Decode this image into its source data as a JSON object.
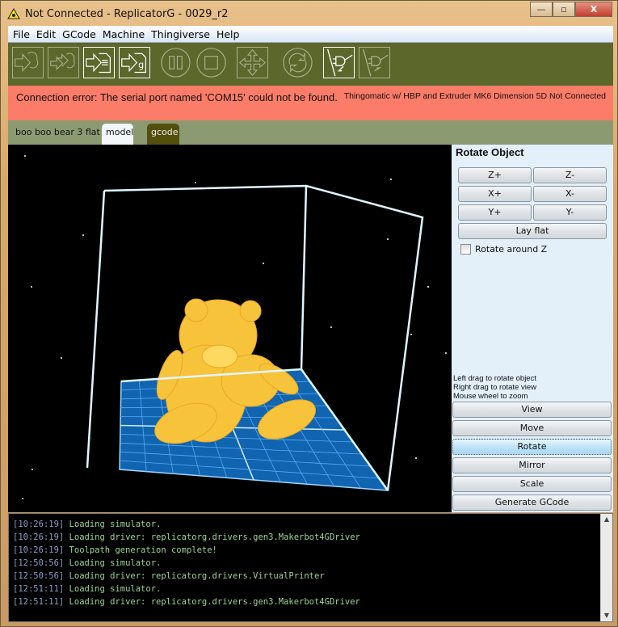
{
  "window": {
    "title": "Not Connected - ReplicatorG - 0029_r2",
    "controls": {
      "minimize": "—",
      "maximize": "▫",
      "close": "X"
    }
  },
  "menu": [
    "File",
    "Edit",
    "GCode",
    "Machine",
    "Thingiverse",
    "Help"
  ],
  "toolbar": [
    {
      "name": "build-icon",
      "enabled": false
    },
    {
      "name": "upload-icon",
      "enabled": false
    },
    {
      "name": "build-to-file-icon",
      "enabled": true
    },
    {
      "name": "build-gcode-icon",
      "enabled": true
    },
    {
      "name": "pause-icon",
      "enabled": false
    },
    {
      "name": "stop-icon",
      "enabled": false
    },
    {
      "name": "control-panel-icon",
      "enabled": false
    },
    {
      "name": "reset-icon",
      "enabled": false
    },
    {
      "name": "connect-icon",
      "enabled": true
    },
    {
      "name": "disconnect-icon",
      "enabled": false
    }
  ],
  "status": {
    "error": "Connection error: The serial port named 'COM15' could not be found.",
    "machine": "Thingomatic w/ HBP and Extruder MK6 Dimension 5D Not Connected",
    "color": "#fb7c68"
  },
  "tabs": {
    "filename": "boo boo bear 3 flat",
    "model": "model",
    "gcode": "gcode"
  },
  "panel": {
    "title": "Rotate Object",
    "buttons": {
      "zp": "Z+",
      "zm": "Z-",
      "xp": "X+",
      "xm": "X-",
      "yp": "Y+",
      "ym": "Y-",
      "layflat": "Lay flat"
    },
    "checkbox": {
      "label": "Rotate around Z",
      "checked": false
    },
    "hints": [
      "Left drag to rotate object",
      "Right drag to rotate view",
      "Mouse wheel to zoom"
    ],
    "modes": [
      "View",
      "Move",
      "Rotate",
      "Mirror",
      "Scale",
      "Generate GCode"
    ],
    "active_mode": "Rotate"
  },
  "console": [
    {
      "t": "[10:26:19]",
      "m": "Loading simulator."
    },
    {
      "t": "[10:26:19]",
      "m": "Loading driver: replicatorg.drivers.gen3.Makerbot4GDriver"
    },
    {
      "t": "[10:26:19]",
      "m": "Toolpath generation complete!"
    },
    {
      "t": "[12:50:56]",
      "m": "Loading simulator."
    },
    {
      "t": "[12:50:56]",
      "m": "Loading driver: replicatorg.drivers.VirtualPrinter"
    },
    {
      "t": "[12:51:11]",
      "m": "Loading simulator."
    },
    {
      "t": "[12:51:11]",
      "m": "Loading driver: replicatorg.drivers.gen3.Makerbot4GDriver"
    }
  ]
}
